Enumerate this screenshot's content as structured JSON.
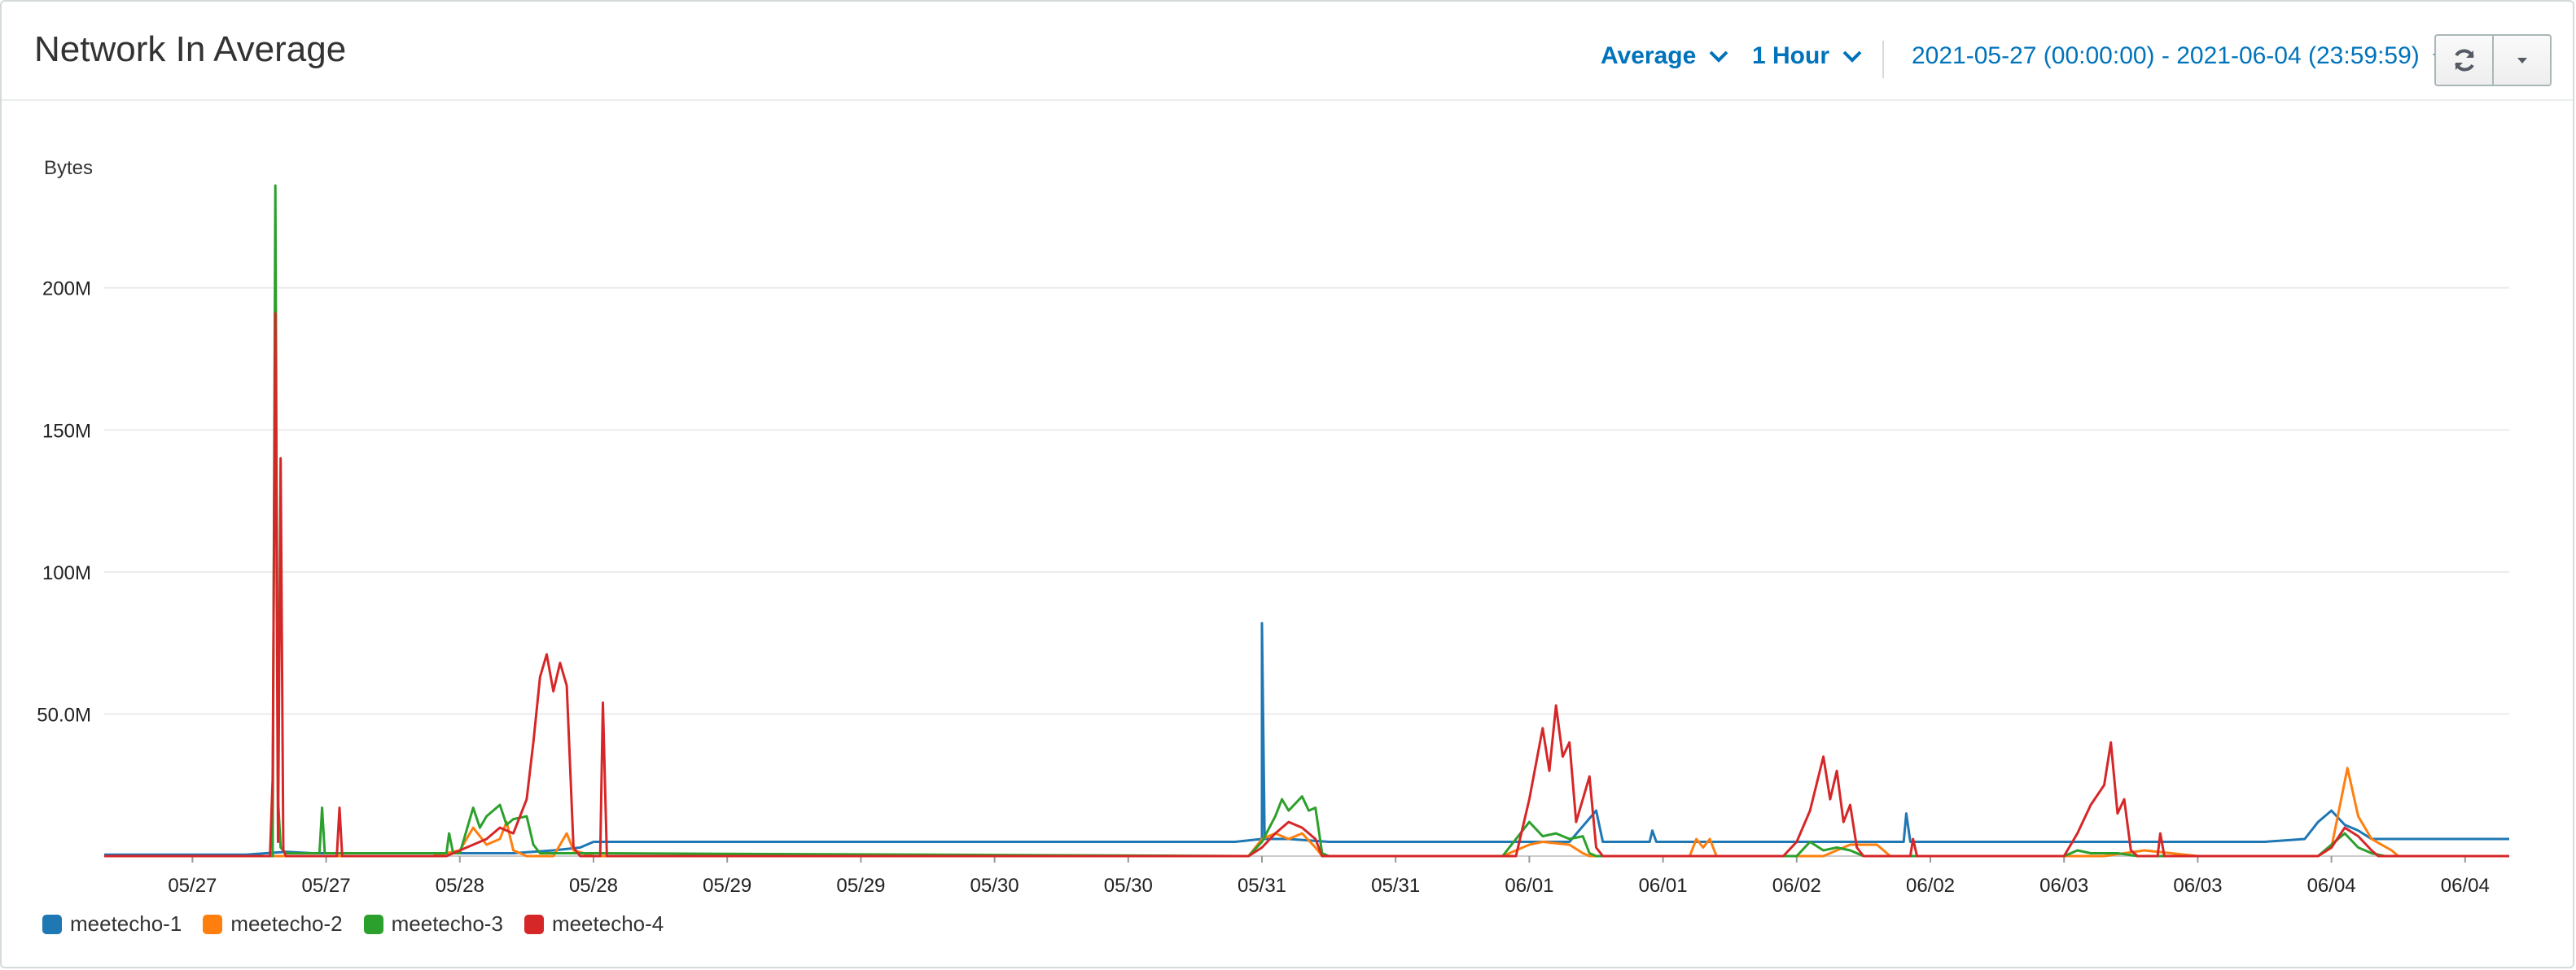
{
  "header": {
    "title": "Network In Average",
    "statistic": "Average",
    "period": "1 Hour",
    "time_range": "2021-05-27 (00:00:00) - 2021-06-04 (23:59:59)"
  },
  "icons": {
    "refresh": "refresh-icon",
    "dropdown": "caret-down-icon",
    "chevron": "chevron-down-icon"
  },
  "chart_data": {
    "type": "line",
    "ylabel": "Bytes",
    "y_ticks": [
      "200M",
      "150M",
      "100M",
      "50.0M"
    ],
    "y_tick_values": [
      200,
      150,
      100,
      50
    ],
    "ylim": [
      0,
      240
    ],
    "y_unit": "M",
    "x_tick_labels": [
      "05/27",
      "05/27",
      "05/28",
      "05/28",
      "05/29",
      "05/29",
      "05/30",
      "05/30",
      "05/31",
      "05/31",
      "06/01",
      "06/01",
      "06/02",
      "06/02",
      "06/03",
      "06/03",
      "06/04",
      "06/04"
    ],
    "xlim": [
      -0.66,
      17.33
    ],
    "grid": true,
    "legend": "bottom-left",
    "series": [
      {
        "name": "meetecho-1",
        "color": "#1f77b4",
        "points": [
          [
            -0.66,
            0.5
          ],
          [
            -0.1,
            0.5
          ],
          [
            0.4,
            0.5
          ],
          [
            0.7,
            1.5
          ],
          [
            0.9,
            1
          ],
          [
            1.5,
            1
          ],
          [
            2,
            1
          ],
          [
            2.4,
            1
          ],
          [
            2.7,
            2
          ],
          [
            2.9,
            3
          ],
          [
            3.0,
            5
          ],
          [
            3.5,
            5
          ],
          [
            5,
            5
          ],
          [
            7,
            5
          ],
          [
            7.8,
            5
          ],
          [
            8.0,
            6
          ],
          [
            8.0,
            82
          ],
          [
            8.02,
            6
          ],
          [
            8.2,
            6
          ],
          [
            8.5,
            5
          ],
          [
            9.5,
            5
          ],
          [
            10,
            5
          ],
          [
            10.3,
            5
          ],
          [
            10.5,
            16
          ],
          [
            10.55,
            5
          ],
          [
            10.9,
            5
          ],
          [
            10.92,
            9
          ],
          [
            10.95,
            5
          ],
          [
            11.5,
            5
          ],
          [
            12,
            5
          ],
          [
            12.8,
            5
          ],
          [
            12.82,
            15
          ],
          [
            12.85,
            5
          ],
          [
            13.5,
            5
          ],
          [
            14.5,
            5
          ],
          [
            15.5,
            5
          ],
          [
            15.8,
            6
          ],
          [
            15.9,
            12
          ],
          [
            16.0,
            16
          ],
          [
            16.1,
            11
          ],
          [
            16.2,
            9
          ],
          [
            16.3,
            6
          ],
          [
            17.33,
            6
          ]
        ]
      },
      {
        "name": "meetecho-2",
        "color": "#ff7f0e",
        "points": [
          [
            -0.66,
            0
          ],
          [
            1.8,
            0
          ],
          [
            2.0,
            2
          ],
          [
            2.1,
            10
          ],
          [
            2.2,
            4
          ],
          [
            2.3,
            6
          ],
          [
            2.35,
            12
          ],
          [
            2.4,
            2
          ],
          [
            2.5,
            0
          ],
          [
            2.7,
            0
          ],
          [
            2.8,
            8
          ],
          [
            2.85,
            2
          ],
          [
            3.0,
            0
          ],
          [
            7.9,
            0
          ],
          [
            8.0,
            6
          ],
          [
            8.1,
            8
          ],
          [
            8.2,
            6
          ],
          [
            8.3,
            8
          ],
          [
            8.4,
            3
          ],
          [
            8.45,
            0
          ],
          [
            9.8,
            0
          ],
          [
            10.0,
            4
          ],
          [
            10.1,
            5
          ],
          [
            10.3,
            4
          ],
          [
            10.4,
            1
          ],
          [
            10.45,
            0
          ],
          [
            11.2,
            0
          ],
          [
            11.25,
            6
          ],
          [
            11.3,
            3
          ],
          [
            11.35,
            6
          ],
          [
            11.4,
            0
          ],
          [
            12.2,
            0
          ],
          [
            12.4,
            4
          ],
          [
            12.6,
            4
          ],
          [
            12.7,
            0
          ],
          [
            14.3,
            0
          ],
          [
            14.6,
            2
          ],
          [
            14.8,
            1
          ],
          [
            15.0,
            0
          ],
          [
            15.9,
            0
          ],
          [
            16.0,
            3
          ],
          [
            16.12,
            31
          ],
          [
            16.2,
            14
          ],
          [
            16.3,
            6
          ],
          [
            16.45,
            2
          ],
          [
            16.5,
            0
          ],
          [
            17.33,
            0
          ]
        ]
      },
      {
        "name": "meetecho-3",
        "color": "#2ca02c",
        "points": [
          [
            -0.66,
            0
          ],
          [
            0.6,
            0
          ],
          [
            0.6,
            3
          ],
          [
            0.62,
            236
          ],
          [
            0.64,
            20
          ],
          [
            0.66,
            3
          ],
          [
            0.7,
            1
          ],
          [
            0.95,
            1
          ],
          [
            0.97,
            17
          ],
          [
            0.99,
            1
          ],
          [
            1.4,
            1
          ],
          [
            1.9,
            1
          ],
          [
            1.92,
            8
          ],
          [
            1.95,
            1
          ],
          [
            2.0,
            1
          ],
          [
            2.1,
            17
          ],
          [
            2.15,
            10
          ],
          [
            2.2,
            14
          ],
          [
            2.3,
            18
          ],
          [
            2.35,
            11
          ],
          [
            2.4,
            13
          ],
          [
            2.5,
            14
          ],
          [
            2.55,
            4
          ],
          [
            2.6,
            1
          ],
          [
            2.7,
            1
          ],
          [
            3.0,
            1
          ],
          [
            7.9,
            0
          ],
          [
            8.0,
            5
          ],
          [
            8.1,
            14
          ],
          [
            8.15,
            20
          ],
          [
            8.2,
            16
          ],
          [
            8.3,
            21
          ],
          [
            8.35,
            16
          ],
          [
            8.4,
            17
          ],
          [
            8.45,
            1
          ],
          [
            8.5,
            0
          ],
          [
            9.8,
            0
          ],
          [
            10.0,
            12
          ],
          [
            10.1,
            7
          ],
          [
            10.2,
            8
          ],
          [
            10.3,
            6
          ],
          [
            10.4,
            7
          ],
          [
            10.45,
            1
          ],
          [
            10.5,
            0
          ],
          [
            12.0,
            0
          ],
          [
            12.1,
            5
          ],
          [
            12.2,
            2
          ],
          [
            12.3,
            3
          ],
          [
            12.4,
            2
          ],
          [
            12.5,
            0
          ],
          [
            14.0,
            0
          ],
          [
            14.1,
            2
          ],
          [
            14.2,
            1
          ],
          [
            14.4,
            1
          ],
          [
            14.55,
            0
          ],
          [
            15.9,
            0
          ],
          [
            16.0,
            4
          ],
          [
            16.1,
            8
          ],
          [
            16.2,
            3
          ],
          [
            16.3,
            1
          ],
          [
            16.4,
            0
          ],
          [
            17.33,
            0
          ]
        ]
      },
      {
        "name": "meetecho-4",
        "color": "#d62728",
        "points": [
          [
            -0.66,
            0
          ],
          [
            0.58,
            0
          ],
          [
            0.6,
            27
          ],
          [
            0.62,
            191
          ],
          [
            0.64,
            5
          ],
          [
            0.66,
            140
          ],
          [
            0.68,
            2
          ],
          [
            0.7,
            0
          ],
          [
            1.08,
            0
          ],
          [
            1.1,
            17
          ],
          [
            1.12,
            0
          ],
          [
            1.9,
            0
          ],
          [
            2.1,
            4
          ],
          [
            2.2,
            6
          ],
          [
            2.3,
            10
          ],
          [
            2.4,
            8
          ],
          [
            2.5,
            20
          ],
          [
            2.55,
            40
          ],
          [
            2.6,
            63
          ],
          [
            2.65,
            71
          ],
          [
            2.7,
            58
          ],
          [
            2.75,
            68
          ],
          [
            2.8,
            60
          ],
          [
            2.85,
            3
          ],
          [
            2.9,
            0
          ],
          [
            3.05,
            0
          ],
          [
            3.07,
            54
          ],
          [
            3.1,
            0
          ],
          [
            7.9,
            0
          ],
          [
            8.0,
            3
          ],
          [
            8.1,
            8
          ],
          [
            8.2,
            12
          ],
          [
            8.3,
            10
          ],
          [
            8.4,
            6
          ],
          [
            8.45,
            0
          ],
          [
            9.9,
            0
          ],
          [
            10.0,
            20
          ],
          [
            10.1,
            45
          ],
          [
            10.15,
            30
          ],
          [
            10.2,
            53
          ],
          [
            10.25,
            35
          ],
          [
            10.3,
            40
          ],
          [
            10.35,
            12
          ],
          [
            10.4,
            20
          ],
          [
            10.45,
            28
          ],
          [
            10.5,
            3
          ],
          [
            10.55,
            0
          ],
          [
            11.9,
            0
          ],
          [
            12.0,
            5
          ],
          [
            12.1,
            16
          ],
          [
            12.2,
            35
          ],
          [
            12.25,
            20
          ],
          [
            12.3,
            30
          ],
          [
            12.35,
            12
          ],
          [
            12.4,
            18
          ],
          [
            12.45,
            3
          ],
          [
            12.5,
            0
          ],
          [
            12.85,
            0
          ],
          [
            12.87,
            6
          ],
          [
            12.9,
            0
          ],
          [
            14.0,
            0
          ],
          [
            14.1,
            8
          ],
          [
            14.2,
            18
          ],
          [
            14.3,
            25
          ],
          [
            14.35,
            40
          ],
          [
            14.4,
            15
          ],
          [
            14.45,
            20
          ],
          [
            14.5,
            2
          ],
          [
            14.55,
            0
          ],
          [
            14.7,
            0
          ],
          [
            14.72,
            8
          ],
          [
            14.75,
            0
          ],
          [
            15.9,
            0
          ],
          [
            16.0,
            3
          ],
          [
            16.1,
            10
          ],
          [
            16.2,
            7
          ],
          [
            16.3,
            2
          ],
          [
            16.35,
            0
          ],
          [
            17.33,
            0
          ]
        ]
      }
    ]
  }
}
